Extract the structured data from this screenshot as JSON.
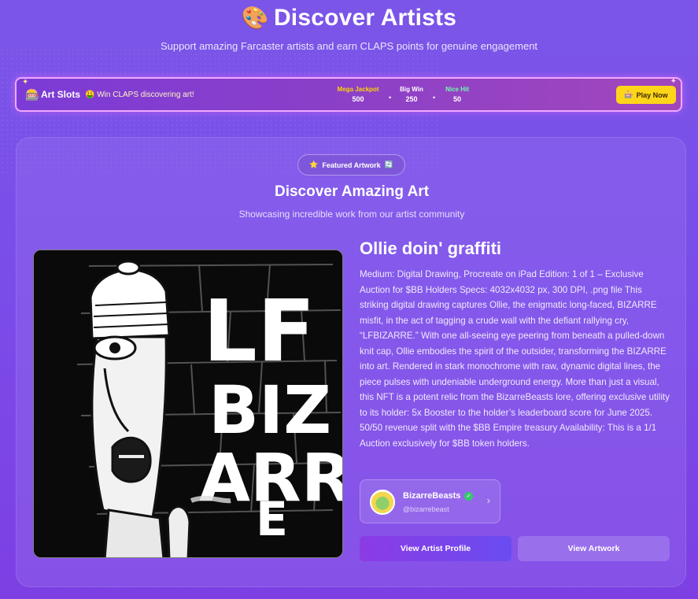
{
  "header": {
    "title_icon": "palette-icon",
    "title_emoji": "🎨",
    "title": "Discover Artists",
    "subtitle": "Support amazing Farcaster artists and earn CLAPS points for genuine engagement"
  },
  "slots": {
    "icon": "🎰",
    "title": "Art Slots",
    "tagline": "🤑 Win CLAPS discovering art!",
    "prizes": [
      {
        "label": "Mega Jackpot",
        "value": "500",
        "color": "#ffd400"
      },
      {
        "label": "Big Win",
        "value": "250",
        "color": "#ffffff"
      },
      {
        "label": "Nice Hit",
        "value": "50",
        "color": "#6dffa5"
      }
    ],
    "play_icon": "🎰",
    "play_label": "Play Now"
  },
  "featured": {
    "pill_icon": "⭐",
    "pill_label": "Featured Artwork",
    "pill_trailing": "🔄",
    "section_title": "Discover Amazing Art",
    "section_subtitle": "Showcasing incredible work from our artist community",
    "art": {
      "title": "Ollie doin' graffiti",
      "image_text_lines": [
        "LF",
        "BIZ",
        "ARR",
        "E"
      ],
      "description": "Medium: Digital Drawing, Procreate on iPad Edition: 1 of 1 – Exclusive Auction for $BB Holders Specs: 4032x4032 px, 300 DPI, .png file This striking digital drawing captures Ollie, the enigmatic long-faced, BIZARRE misfit, in the act of tagging a crude wall with the defiant rallying cry, “LFBIZARRE.” With one all-seeing eye peering from beneath a pulled-down knit cap, Ollie embodies the spirit of the outsider, transforming the BIZARRE into art. Rendered in stark monochrome with raw, dynamic digital lines, the piece pulses with undeniable underground energy. More than just a visual, this NFT is a potent relic from the BizarreBeasts lore, offering exclusive utility to its holder: 5x Booster to the holder’s leaderboard score for June 2025. 50/50 revenue split with the $BB Empire treasury Availability: This is a 1/1 Auction exclusively for $BB token holders."
    },
    "artist": {
      "name": "BizarreBeasts",
      "handle": "@bizarrebeast",
      "verified": true
    },
    "buttons": {
      "view_profile": "View Artist Profile",
      "view_artwork": "View Artwork"
    }
  }
}
